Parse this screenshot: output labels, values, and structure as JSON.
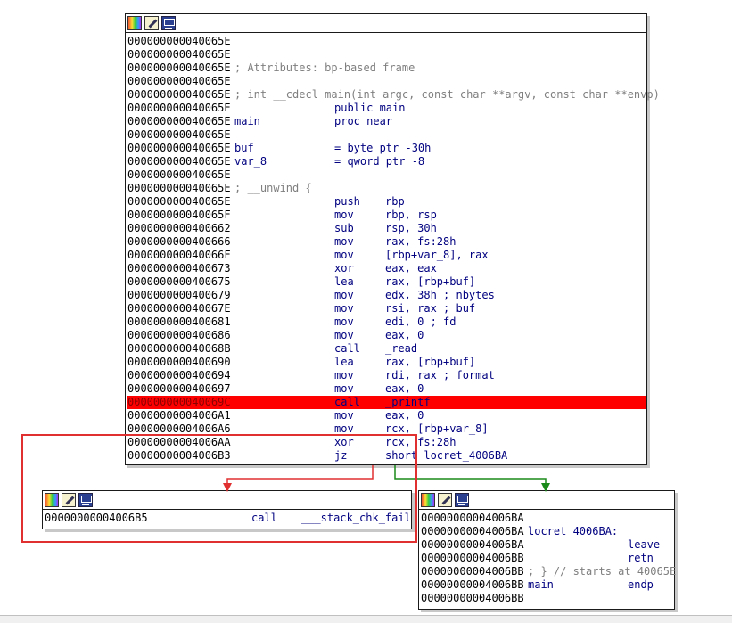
{
  "main_block": {
    "lines": [
      {
        "addr": "000000000040065E",
        "c1": "",
        "c2": "",
        "c3": ""
      },
      {
        "addr": "000000000040065E",
        "c1": "",
        "c2": "",
        "c3": ""
      },
      {
        "addr": "000000000040065E",
        "c1": "",
        "c2": "",
        "c3": "",
        "comment": "; Attributes: bp-based frame"
      },
      {
        "addr": "000000000040065E",
        "c1": "",
        "c2": "",
        "c3": ""
      },
      {
        "addr": "000000000040065E",
        "c1": "",
        "c2": "",
        "c3": "",
        "comment": "; int __cdecl main(int argc, const char **argv, const char **envp)"
      },
      {
        "addr": "000000000040065E",
        "c1": "",
        "c2": "public main",
        "c3": ""
      },
      {
        "addr": "000000000040065E",
        "c1": "main",
        "c2": "proc near",
        "c3": ""
      },
      {
        "addr": "000000000040065E",
        "c1": "",
        "c2": "",
        "c3": ""
      },
      {
        "addr": "000000000040065E",
        "c1": "buf",
        "c2": "= byte ptr -30h",
        "c3": ""
      },
      {
        "addr": "000000000040065E",
        "c1": "var_8",
        "c2": "= qword ptr -8",
        "c3": ""
      },
      {
        "addr": "000000000040065E",
        "c1": "",
        "c2": "",
        "c3": ""
      },
      {
        "addr": "000000000040065E",
        "c1": "",
        "c2": "",
        "c3": "",
        "comment": "; __unwind {"
      },
      {
        "addr": "000000000040065E",
        "c1": "",
        "c2": "push",
        "c3": "rbp"
      },
      {
        "addr": "000000000040065F",
        "c1": "",
        "c2": "mov",
        "c3": "rbp, rsp"
      },
      {
        "addr": "0000000000400662",
        "c1": "",
        "c2": "sub",
        "c3": "rsp, 30h"
      },
      {
        "addr": "0000000000400666",
        "c1": "",
        "c2": "mov",
        "c3": "rax, fs:28h"
      },
      {
        "addr": "000000000040066F",
        "c1": "",
        "c2": "mov",
        "c3": "[rbp+var_8], rax"
      },
      {
        "addr": "0000000000400673",
        "c1": "",
        "c2": "xor",
        "c3": "eax, eax"
      },
      {
        "addr": "0000000000400675",
        "c1": "",
        "c2": "lea",
        "c3": "rax, [rbp+buf]"
      },
      {
        "addr": "0000000000400679",
        "c1": "",
        "c2": "mov",
        "c3": "edx, 38h ; nbytes"
      },
      {
        "addr": "000000000040067E",
        "c1": "",
        "c2": "mov",
        "c3": "rsi, rax ; buf"
      },
      {
        "addr": "0000000000400681",
        "c1": "",
        "c2": "mov",
        "c3": "edi, 0 ; fd"
      },
      {
        "addr": "0000000000400686",
        "c1": "",
        "c2": "mov",
        "c3": "eax, 0"
      },
      {
        "addr": "000000000040068B",
        "c1": "",
        "c2": "call",
        "c3": "_read"
      },
      {
        "addr": "0000000000400690",
        "c1": "",
        "c2": "lea",
        "c3": "rax, [rbp+buf]"
      },
      {
        "addr": "0000000000400694",
        "c1": "",
        "c2": "mov",
        "c3": "rdi, rax ; format"
      },
      {
        "addr": "0000000000400697",
        "c1": "",
        "c2": "mov",
        "c3": "eax, 0"
      },
      {
        "addr": "000000000040069C",
        "c1": "",
        "c2": "call",
        "c3": "_printf",
        "highlight": true
      },
      {
        "addr": "00000000004006A1",
        "c1": "",
        "c2": "mov",
        "c3": "eax, 0"
      },
      {
        "addr": "00000000004006A6",
        "c1": "",
        "c2": "mov",
        "c3": "rcx, [rbp+var_8]"
      },
      {
        "addr": "00000000004006AA",
        "c1": "",
        "c2": "xor",
        "c3": "rcx, fs:28h"
      },
      {
        "addr": "00000000004006B3",
        "c1": "",
        "c2": "jz",
        "c3": "short locret_4006BA"
      }
    ]
  },
  "fail_block": {
    "lines": [
      {
        "addr": "00000000004006B5",
        "c2": "call",
        "c3": "___stack_chk_fail"
      }
    ]
  },
  "ret_block": {
    "lines": [
      {
        "addr": "00000000004006BA",
        "c1": "",
        "c2": "",
        "c3": ""
      },
      {
        "addr": "00000000004006BA",
        "c1": "locret_4006BA:",
        "c2": "",
        "c3": ""
      },
      {
        "addr": "00000000004006BA",
        "c1": "",
        "c2": "leave",
        "c3": ""
      },
      {
        "addr": "00000000004006BB",
        "c1": "",
        "c2": "retn",
        "c3": ""
      },
      {
        "addr": "00000000004006BB",
        "c1": "",
        "c2": "",
        "c3": "",
        "comment": "; } // starts at 40065E"
      },
      {
        "addr": "00000000004006BB",
        "c1": "main",
        "c2": "endp",
        "c3": ""
      },
      {
        "addr": "00000000004006BB",
        "c1": "",
        "c2": "",
        "c3": ""
      }
    ]
  },
  "icons": {
    "graph": "graph-colors-icon",
    "edit": "edit-pencil-icon",
    "group": "group-nodes-icon"
  },
  "colors": {
    "highlight": "#ff0000",
    "edge_false": "#e03030",
    "edge_true": "#1a8a1a",
    "selection": "#e03030",
    "code_text": "#000080",
    "comment": "#7f7f7f"
  }
}
